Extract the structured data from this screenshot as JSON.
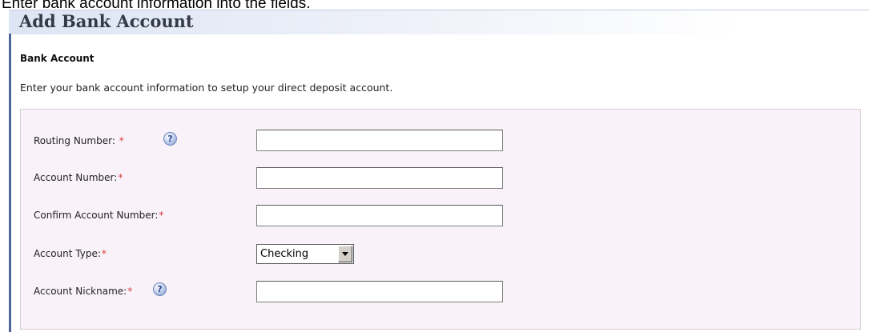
{
  "instruction": "Enter bank account information into the fields.",
  "page": {
    "title": "Add Bank Account"
  },
  "section": {
    "heading": "Bank Account",
    "description": "Enter your bank account information to setup your direct deposit account."
  },
  "form": {
    "required_marker": "*",
    "help_icon_glyph": "?",
    "routing_number": {
      "label": "Routing Number:",
      "value": "",
      "icon": "help-icon"
    },
    "account_number": {
      "label": "Account Number:",
      "value": ""
    },
    "confirm_account_number": {
      "label": "Confirm Account Number:",
      "value": ""
    },
    "account_type": {
      "label": "Account Type:",
      "selected": "Checking"
    },
    "account_nickname": {
      "label": "Account Nickname:",
      "value": "",
      "icon": "help-icon"
    }
  },
  "colors": {
    "accent_rule": "#4d6699",
    "panel_background": "#f9f2f8",
    "required_marker": "#d83a3a"
  }
}
